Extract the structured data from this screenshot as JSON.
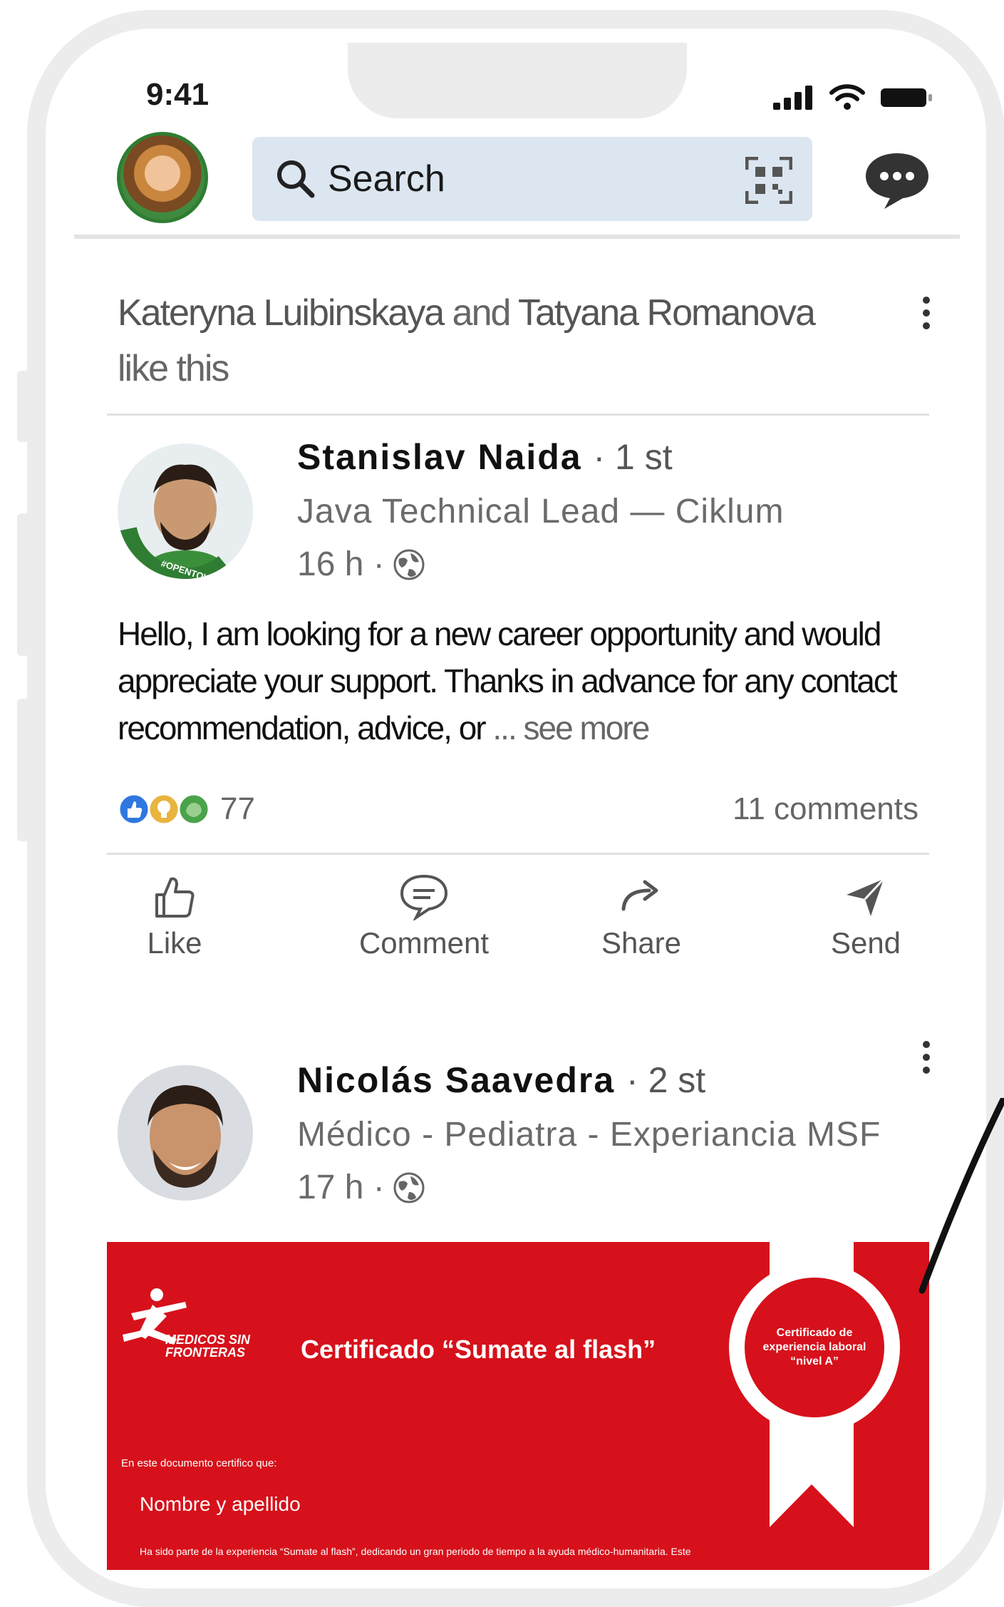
{
  "status_bar": {
    "time": "9:41"
  },
  "header": {
    "search_placeholder": "Search"
  },
  "feed": {
    "social_context": {
      "person1": "Kateryna Luibinskaya",
      "connector": "and",
      "person2": "Tatyana Romanova",
      "suffix": "like this"
    },
    "post1": {
      "author": "Stanislav Naida",
      "degree": "· 1 st",
      "headline": "Java Technical Lead — Ciklum",
      "time": "16 h ·",
      "text": "Hello, I am looking for a new career opportunity and would appreciate your support. Thanks in advance for any contact recommendation, advice, or",
      "see_more": "... see more",
      "reaction_count": "77",
      "comments": "11 comments",
      "actions": {
        "like": "Like",
        "comment": "Comment",
        "share": "Share",
        "send": "Send"
      }
    },
    "post2": {
      "author": "Nicolás Saavedra",
      "degree": "· 2 st",
      "headline": "Médico - Pediatra - Experiancia MSF",
      "time": "17 h ·",
      "image": {
        "logo_text": "MEDICOS SIN FRONTERAS",
        "title": "Certificado “Sumate al flash”",
        "seal_text": "Certificado de experiencia laboral “nivel A”",
        "line1": "En este documento certifico que:",
        "name_field": "Nombre y apellido",
        "line2": "Ha sido parte de la experiencia “Sumate al flash”, dedicando un gran periodo de tiempo a la ayuda médico-humanitaria. Este"
      }
    }
  },
  "colors": {
    "accent_red": "#d6111b",
    "search_bg": "#dce6f1",
    "like_blue": "#2f77e0"
  }
}
